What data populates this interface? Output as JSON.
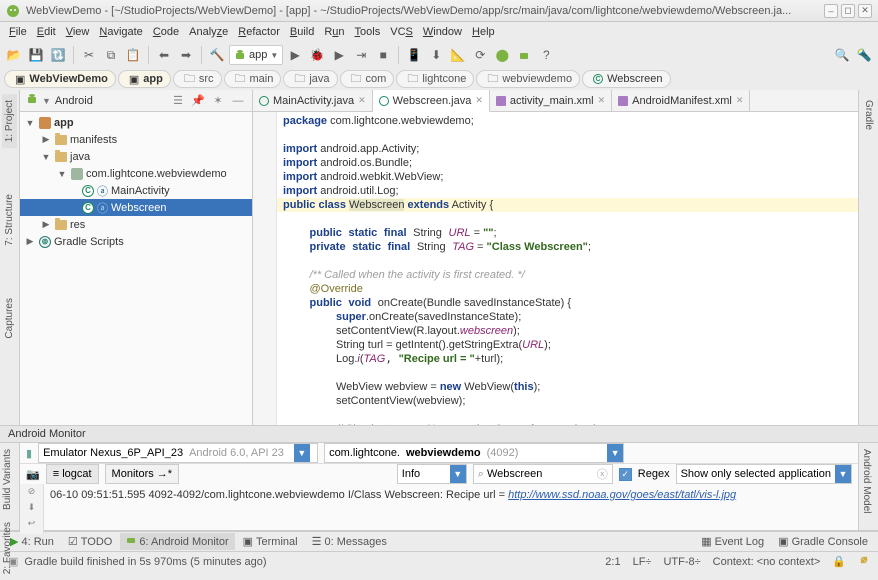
{
  "title": "WebViewDemo - [~/StudioProjects/WebViewDemo] - [app] - ~/StudioProjects/WebViewDemo/app/src/main/java/com/lightcone/webviewdemo/Webscreen.ja...",
  "win": {
    "min": "–",
    "max": "◻",
    "close": "✕"
  },
  "menu": {
    "file": "File",
    "edit": "Edit",
    "view": "View",
    "navigate": "Navigate",
    "code": "Code",
    "analyze": "Analyze",
    "refactor": "Refactor",
    "build": "Build",
    "run": "Run",
    "tools": "Tools",
    "vcs": "VCS",
    "window": "Window",
    "help": "Help"
  },
  "appconfig": "app",
  "crumbs": {
    "c0": "WebViewDemo",
    "c1": "app",
    "c2": "src",
    "c3": "main",
    "c4": "java",
    "c5": "com",
    "c6": "lightcone",
    "c7": "webviewdemo",
    "c8": "Webscreen"
  },
  "sidetabs": {
    "project": "1: Project",
    "structure": "7: Structure",
    "captures": "Captures",
    "buildvar": "Build Variants",
    "favorites": "2: Favorites",
    "gradle": "Gradle",
    "amodel": "Android Model"
  },
  "tree": {
    "view_mode": "Android",
    "app": "app",
    "manifests": "manifests",
    "java": "java",
    "pkg": "com.lightcone.webviewdemo",
    "mainact": "MainActivity",
    "webscreen": "Webscreen",
    "res": "res",
    "gradle": "Gradle Scripts"
  },
  "tabs": {
    "t0": "MainActivity.java",
    "t1": "Webscreen.java",
    "t2": "activity_main.xml",
    "t3": "AndroidManifest.xml"
  },
  "code": {
    "pkg_kw": "package",
    "pkg_val": " com.lightcone.webviewdemo;",
    "imp_kw": "import",
    "imp1": " android.app.Activity;",
    "imp2": " android.os.Bundle;",
    "imp3": " android.webkit.WebView;",
    "imp4": " android.util.Log;",
    "pub": "public",
    "cls": "class",
    "clsname": "Webscreen",
    "ext": "extends",
    "sup": "Activity",
    "ob": " {",
    "static": "static",
    "final": "final",
    "str_t": "String",
    "url_f": "URL",
    "eq": " = ",
    "empty": "\"\"",
    "semi": ";",
    "prv": "private",
    "tag_f": "TAG",
    "tag_v": "\"Class Webscreen\"",
    "cmt1": "/** Called when the activity is first created. */",
    "ovr": "@Override",
    "void": "void",
    "oncreate": "onCreate",
    "parm": "(Bundle savedInstanceState) {",
    "super": "super",
    "l1": ".onCreate(savedInstanceState);",
    "l2a": "setContentView(R.layout.",
    "l2b": "webscreen",
    "l2c": ");",
    "l3": "String turl = getIntent().getStringExtra(",
    "l3b": ");",
    "l4a": "Log.",
    "l4i": "i",
    "l4p": "(",
    "l4s": "\"Recipe url = \"",
    "l4r": "+turl);",
    "l5a": "WebView webview = ",
    "new": "new",
    "l5b": " WebView(",
    "this": "this",
    "l5c": ");",
    "l6": "setContentView(webview);",
    "cmt2": "// Simplest usage: No exception thrown for page-load error"
  },
  "monitor": {
    "title": "Android Monitor",
    "device": "Emulator Nexus_6P_API_23",
    "device_gray": " Android 6.0, API 23",
    "proc_a": "com.lightcone.",
    "proc_b": "webviewdemo",
    "proc_c": " (4092)",
    "tab1": "logcat",
    "tab2": "Monitors →*",
    "level": "Info",
    "search": "Webscreen",
    "regex": "Regex",
    "filter": "Show only selected application",
    "log_pre": "06-10 09:51:51.595 4092-4092/com.lightcone.webviewdemo I/Class Webscreen: Recipe url = ",
    "log_url": "http://www.ssd.noaa.gov/goes/east/tatl/vis-l.jpg"
  },
  "bottom": {
    "run": "4: Run",
    "todo": "TODO",
    "amon": "6: Android Monitor",
    "term": "Terminal",
    "msg": "0: Messages",
    "elog": "Event Log",
    "gcon": "Gradle Console"
  },
  "status": {
    "msg": "Gradle build finished in 5s 970ms (5 minutes ago)",
    "pos": "2:1",
    "lf": "LF÷",
    "enc": "UTF-8÷",
    "ctx": "Context: <no context>"
  }
}
